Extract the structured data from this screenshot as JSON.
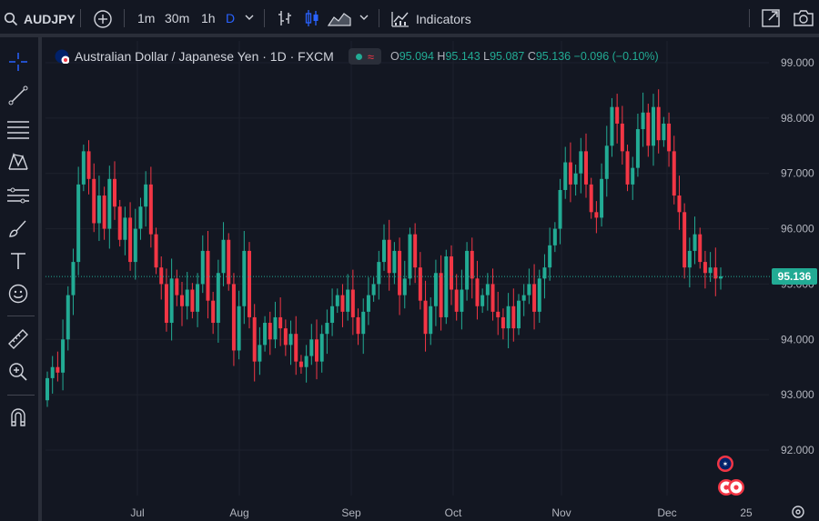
{
  "toolbar": {
    "symbol": "AUDJPY",
    "intervals": [
      "1m",
      "30m",
      "1h",
      "D"
    ],
    "active_interval": "D",
    "indicators_label": "Indicators"
  },
  "legend": {
    "title": "Australian Dollar / Japanese Yen · 1D · FXCM",
    "o_key": "O",
    "o": "95.094",
    "h_key": "H",
    "h": "95.143",
    "l_key": "L",
    "l": "95.087",
    "c_key": "C",
    "c": "95.136",
    "change": "−0.096 (−0.10%)"
  },
  "current_price": "95.136",
  "colors": {
    "up": "#22ab94",
    "down": "#f23645",
    "bg": "#131722",
    "grid": "#1e222d"
  },
  "chart_data": {
    "type": "candlestick",
    "y_ticks": [
      "99.000",
      "98.000",
      "97.000",
      "96.000",
      "95.000",
      "94.000",
      "93.000",
      "92.000"
    ],
    "x_ticks": [
      "Jul",
      "Aug",
      "Sep",
      "Oct",
      "Nov",
      "Dec",
      "25"
    ],
    "last_price": 95.136,
    "closes": [
      93.3,
      93.5,
      93.4,
      94.0,
      94.8,
      95.4,
      96.8,
      97.4,
      96.9,
      96.1,
      96.6,
      96.0,
      96.9,
      96.4,
      95.8,
      96.2,
      95.4,
      96.0,
      96.4,
      96.8,
      95.9,
      95.3,
      95.0,
      94.3,
      95.1,
      94.8,
      94.6,
      94.9,
      94.5,
      95.0,
      95.6,
      94.7,
      94.3,
      95.2,
      95.8,
      95.0,
      93.8,
      94.6,
      95.6,
      94.4,
      93.6,
      93.9,
      94.3,
      94.0,
      94.4,
      94.2,
      93.9,
      94.1,
      93.6,
      93.5,
      93.7,
      94.0,
      93.6,
      94.1,
      94.3,
      94.6,
      94.8,
      94.5,
      94.9,
      94.4,
      94.1,
      94.5,
      94.8,
      95.0,
      95.4,
      95.8,
      95.2,
      95.6,
      94.8,
      95.1,
      95.9,
      95.3,
      94.7,
      94.1,
      94.6,
      95.2,
      94.4,
      95.5,
      94.9,
      94.5,
      94.9,
      95.6,
      95.1,
      94.6,
      94.8,
      95.0,
      94.5,
      94.4,
      94.2,
      94.6,
      94.2,
      94.7,
      94.8,
      95.0,
      94.5,
      95.1,
      95.3,
      95.7,
      96.0,
      96.7,
      97.2,
      96.8,
      97.0,
      97.4,
      96.8,
      96.3,
      96.2,
      96.9,
      97.5,
      98.2,
      97.9,
      97.4,
      96.8,
      97.1,
      97.8,
      98.1,
      97.5,
      98.2,
      97.6,
      97.9,
      97.4,
      96.6,
      96.3,
      95.3,
      95.6,
      95.9,
      95.4,
      95.2,
      95.3,
      95.1,
      95.14
    ]
  },
  "left_tools": [
    "crosshair-icon",
    "trend-line-icon",
    "fib-retracement-icon",
    "pattern-icon",
    "prediction-icon",
    "brush-icon",
    "text-icon",
    "emoji-icon",
    "ruler-icon",
    "zoom-in-icon",
    "magnet-icon"
  ]
}
